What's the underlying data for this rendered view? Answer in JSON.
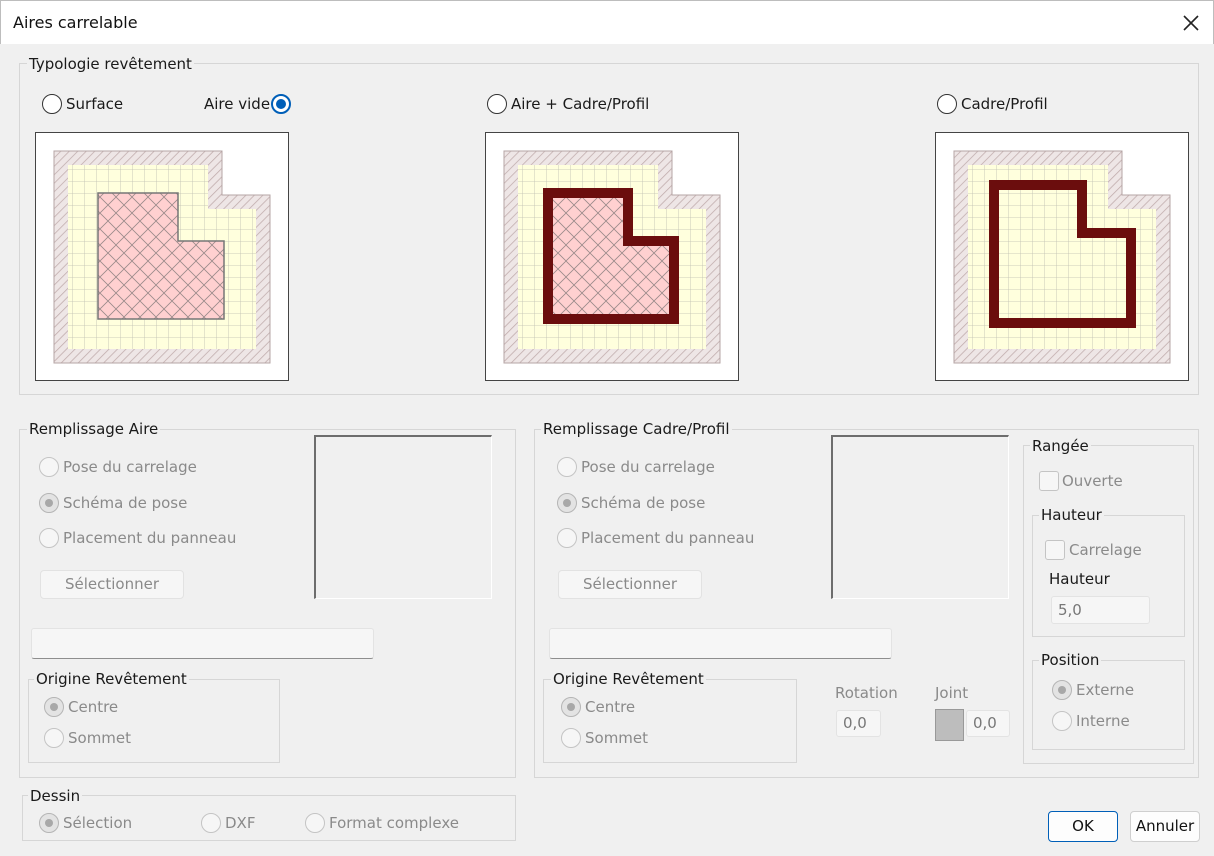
{
  "window": {
    "title": "Aires carrelable"
  },
  "typologie": {
    "legend": "Typologie revêtement",
    "options": [
      "Surface",
      "Aire vide",
      "Aire + Cadre/Profil",
      "Cadre/Profil"
    ],
    "selected": "Aire vide"
  },
  "remplissage_aire": {
    "legend": "Remplissage Aire",
    "options": [
      "Pose du carrelage",
      "Schéma de pose",
      "Placement du panneau"
    ],
    "select_label": "Sélectionner",
    "origine": {
      "legend": "Origine Revêtement",
      "options": [
        "Centre",
        "Sommet"
      ]
    }
  },
  "remplissage_cadre": {
    "legend": "Remplissage Cadre/Profil",
    "options": [
      "Pose du carrelage",
      "Schéma de pose",
      "Placement du panneau"
    ],
    "select_label": "Sélectionner",
    "origine": {
      "legend": "Origine Revêtement",
      "options": [
        "Centre",
        "Sommet"
      ]
    },
    "rotation_label": "Rotation",
    "rotation_value": "0,0",
    "joint_label": "Joint",
    "joint_value": "0,0",
    "joint_color": "#bdbdbd"
  },
  "rangee": {
    "legend": "Rangée",
    "ouverte_label": "Ouverte",
    "hauteur": {
      "legend": "Hauteur",
      "carrelage_label": "Carrelage",
      "hauteur_label": "Hauteur",
      "hauteur_value": "5,0"
    },
    "position": {
      "legend": "Position",
      "options": [
        "Externe",
        "Interne"
      ]
    }
  },
  "dessin": {
    "legend": "Dessin",
    "options": [
      "Sélection",
      "DXF",
      "Format complexe"
    ]
  },
  "buttons": {
    "ok": "OK",
    "cancel": "Annuler"
  },
  "colors": {
    "accent": "#005fb8",
    "tile_fill": "#ffffdd",
    "area_fill": "#ffd0d0",
    "frame_fill": "#6b0d0d",
    "border_hatch": "#c9b8b8"
  }
}
